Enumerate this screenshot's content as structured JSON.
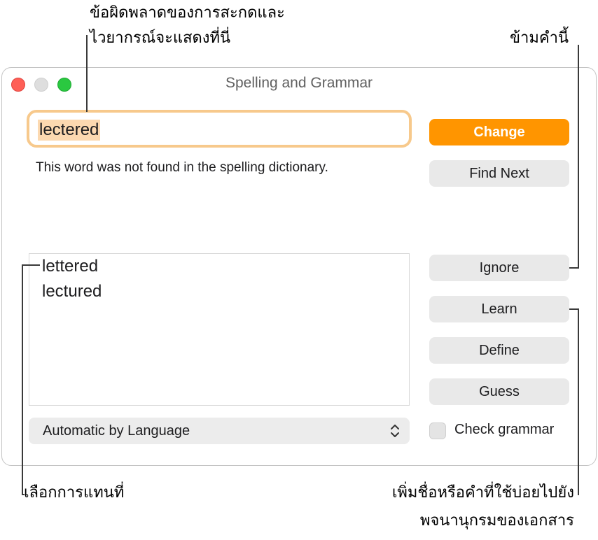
{
  "callouts": {
    "error_display": [
      "ข้อผิดพลาดของการสะกดและ",
      "ไวยากรณ์จะแสดงที่นี่"
    ],
    "skip_word": "ข้ามคำนี้",
    "choose_replacement": "เลือกการแทนที่",
    "add_to_dictionary": [
      "เพิ่มชื่อหรือคำที่ใช้บ่อยไปยัง",
      "พจนานุกรมของเอกสาร"
    ]
  },
  "window": {
    "title": "Spelling and Grammar",
    "misspelled_word": "lectered",
    "message": "This word was not found in the spelling dictionary.",
    "suggestions": [
      "lettered",
      "lectured"
    ],
    "language_select": "Automatic by Language",
    "buttons": {
      "change": "Change",
      "find_next": "Find Next",
      "ignore": "Ignore",
      "learn": "Learn",
      "define": "Define",
      "guess": "Guess"
    },
    "check_grammar": {
      "label": "Check grammar",
      "checked": false
    }
  },
  "colors": {
    "accent": "#ff9500",
    "close": "#fe5f57",
    "maximize": "#2ac840"
  }
}
